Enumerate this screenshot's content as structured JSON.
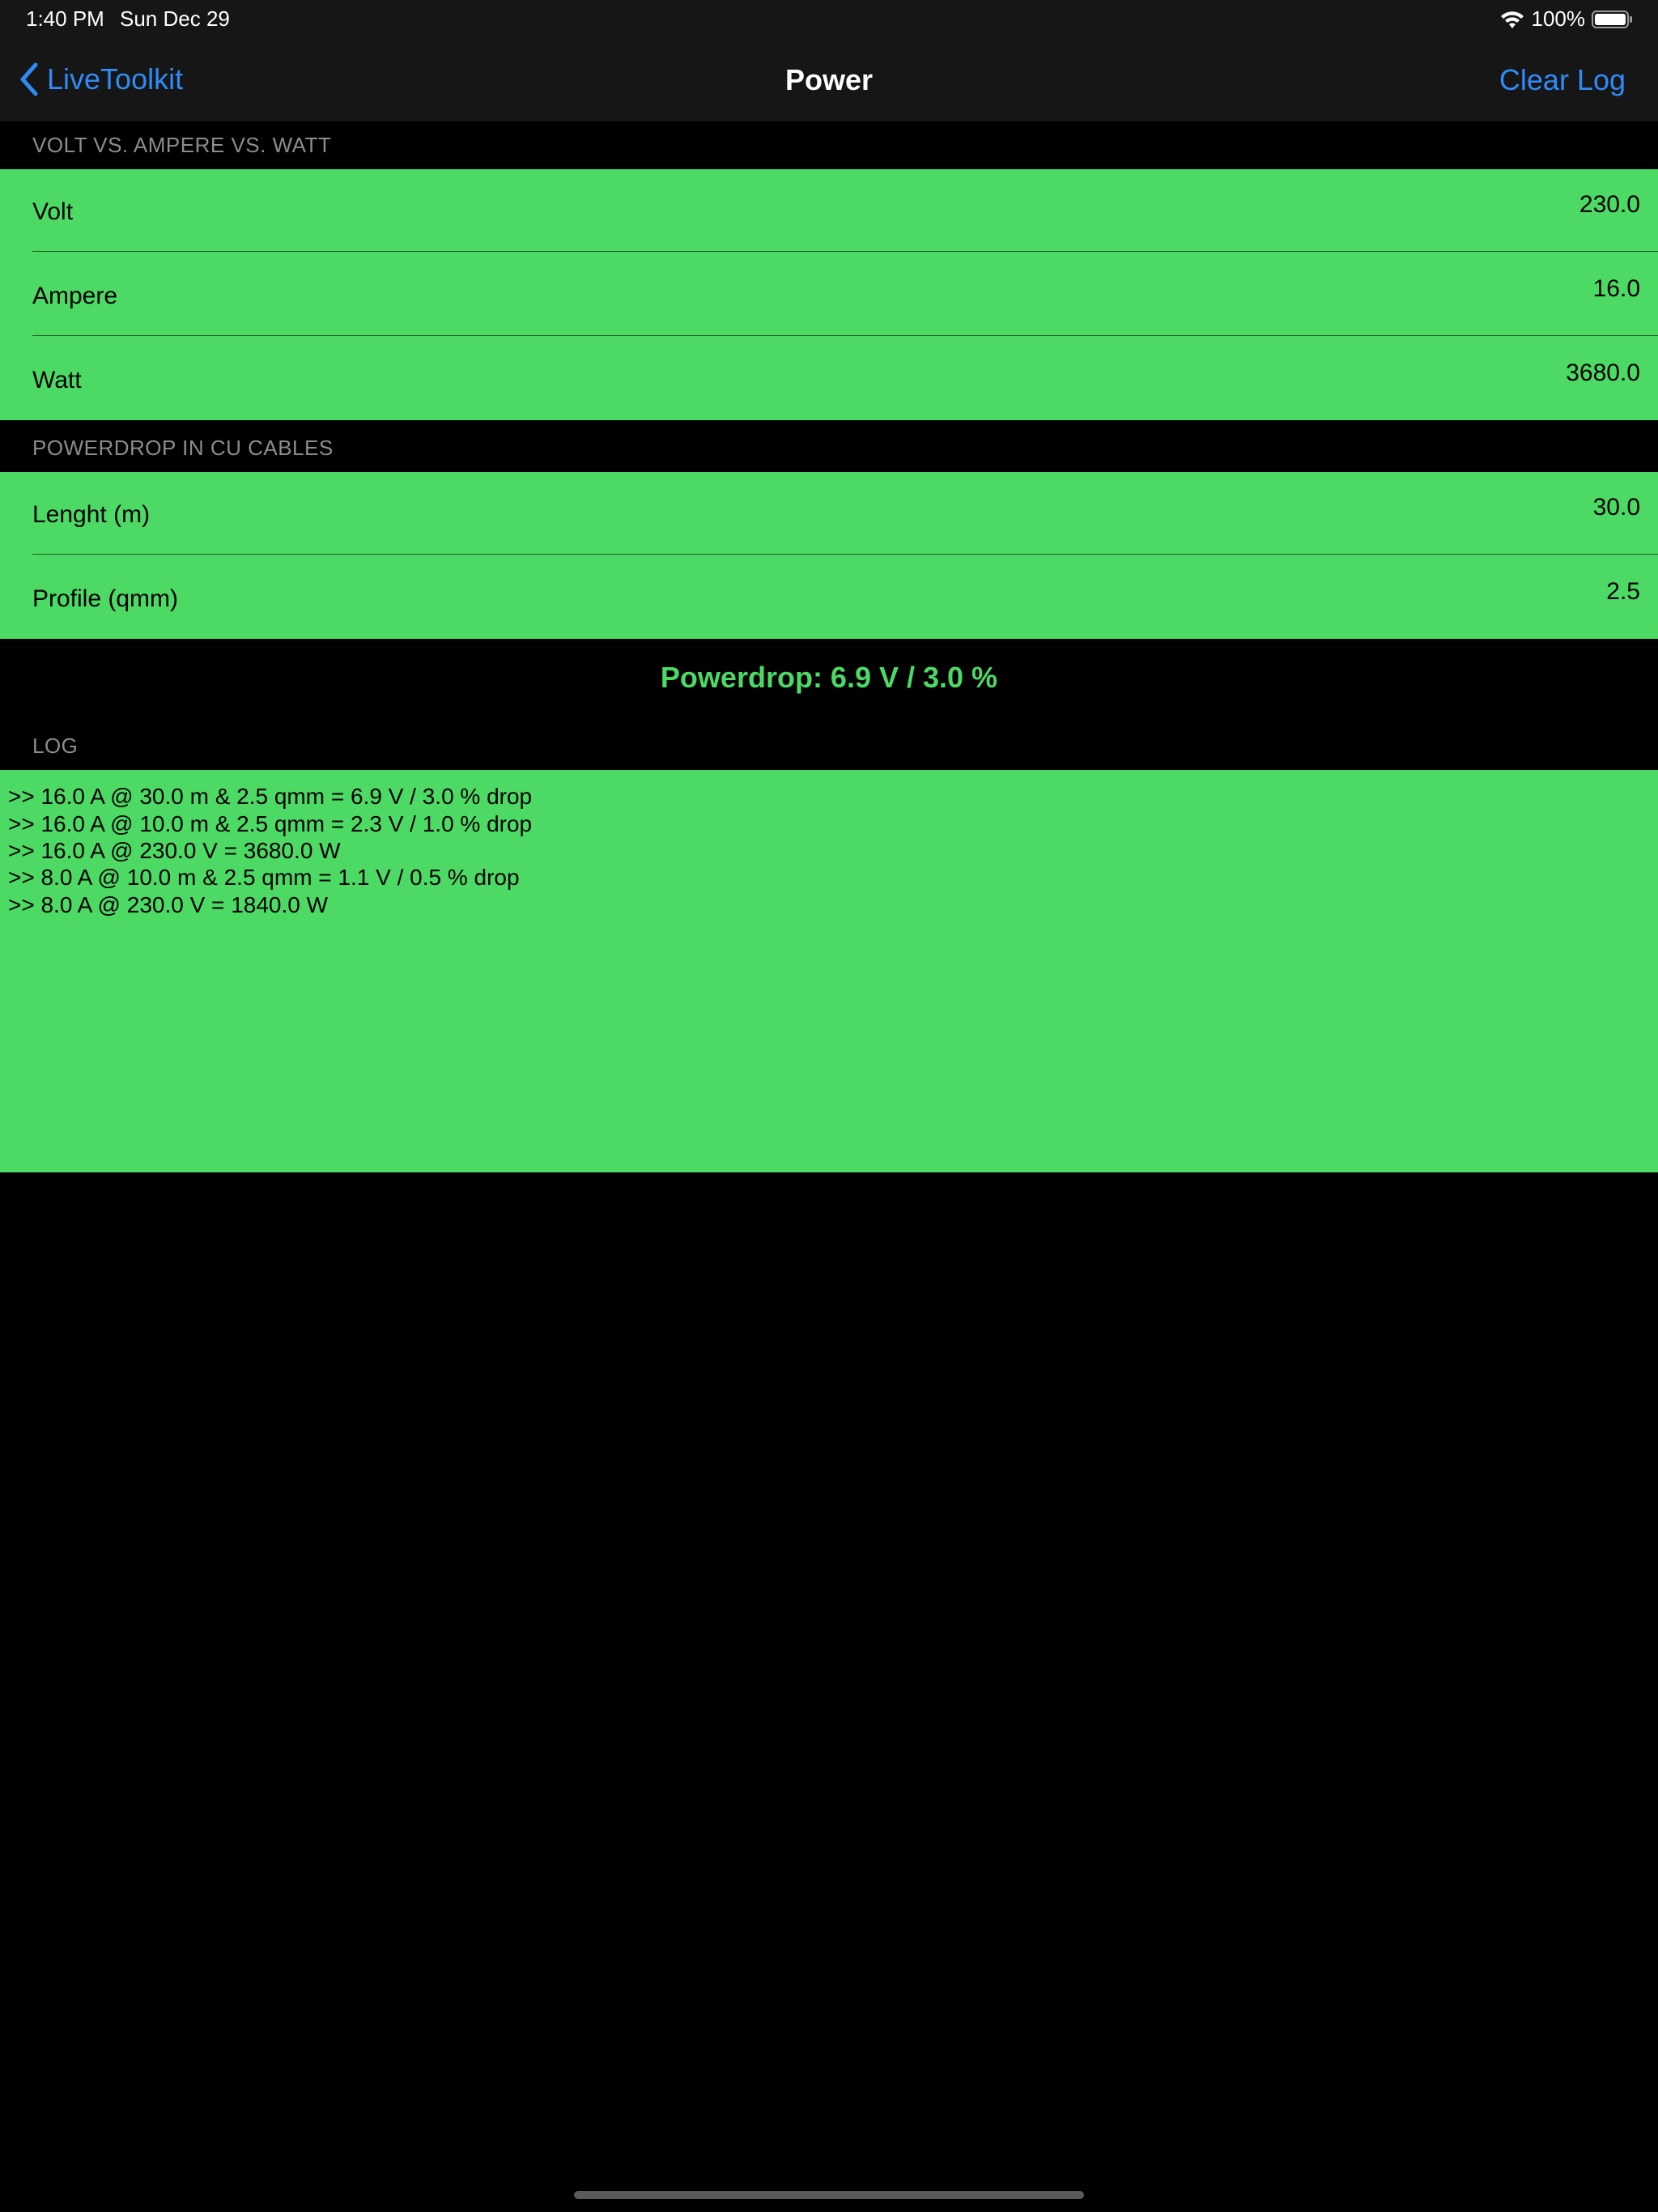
{
  "status_bar": {
    "time": "1:40 PM",
    "date": "Sun Dec 29",
    "battery": "100%"
  },
  "nav": {
    "back_label": "LiveToolkit",
    "title": "Power",
    "action_label": "Clear Log"
  },
  "sections": {
    "power": {
      "header": "VOLT VS. AMPERE VS. WATT",
      "rows": [
        {
          "label": "Volt",
          "value": "230.0"
        },
        {
          "label": "Ampere",
          "value": "16.0"
        },
        {
          "label": "Watt",
          "value": "3680.0"
        }
      ]
    },
    "cable": {
      "header": "POWERDROP IN CU CABLES",
      "rows": [
        {
          "label": "Lenght (m)",
          "value": "30.0"
        },
        {
          "label": "Profile (qmm)",
          "value": "2.5"
        }
      ]
    },
    "result": "Powerdrop: 6.9 V / 3.0 %",
    "log": {
      "header": "LOG",
      "lines": [
        ">> 16.0 A @ 30.0 m & 2.5 qmm = 6.9 V / 3.0 % drop",
        ">> 16.0 A @ 10.0 m & 2.5 qmm = 2.3 V / 1.0 % drop",
        ">> 16.0 A @ 230.0 V = 3680.0 W",
        ">> 8.0 A @ 10.0 m & 2.5 qmm = 1.1 V / 0.5 % drop",
        ">> 8.0 A @ 230.0 V = 1840.0 W"
      ]
    }
  },
  "colors": {
    "accent": "#2f8bf5",
    "row_background": "#4cd964",
    "background": "#000000"
  }
}
